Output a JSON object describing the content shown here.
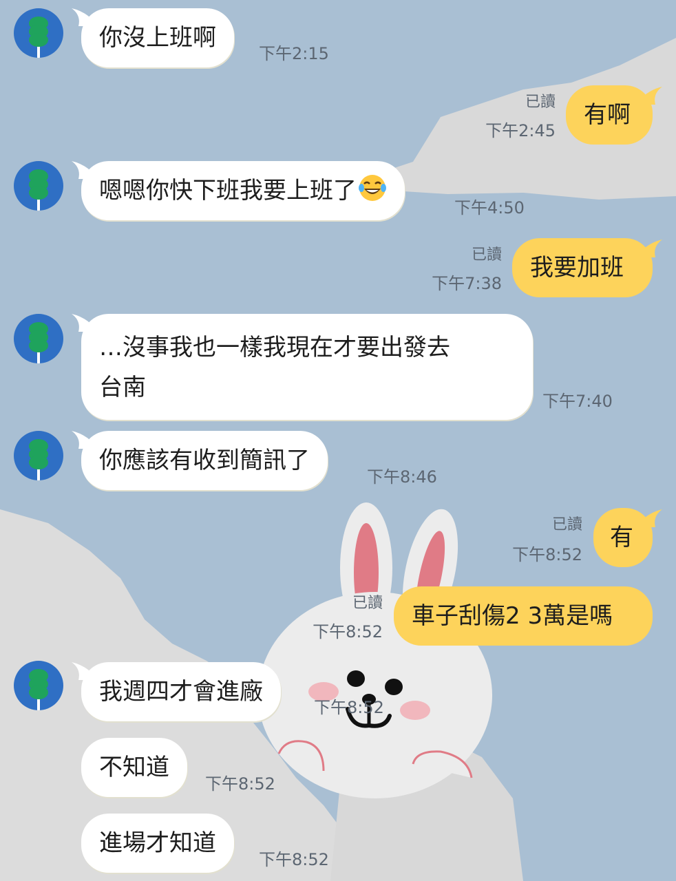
{
  "colors": {
    "background": "#a9bfd3",
    "incoming_bubble": "#ffffff",
    "outgoing_bubble": "#fdd35b",
    "avatar": "#2f6fc4",
    "avatar_icon": "#1fa35c"
  },
  "background_decor": "line-friends-cony-rabbit",
  "messages": [
    {
      "side": "in",
      "text": "你沒上班啊",
      "time": "下午2:15",
      "avatar_icon": "tree-icon"
    },
    {
      "side": "out",
      "text": "有啊",
      "read": "已讀",
      "time": "下午2:45"
    },
    {
      "side": "in",
      "text": "嗯嗯你快下班我要上班了",
      "emoji": "laughing-tears-emoji",
      "time": "下午4:50",
      "avatar_icon": "tree-icon"
    },
    {
      "side": "out",
      "text": "我要加班",
      "read": "已讀",
      "time": "下午7:38"
    },
    {
      "side": "in",
      "line1": "…沒事我也一樣我現在才要出發去",
      "line2": "台南",
      "time": "下午7:40",
      "avatar_icon": "tree-icon"
    },
    {
      "side": "in",
      "text": "你應該有收到簡訊了",
      "time": "下午8:46",
      "avatar_icon": "tree-icon"
    },
    {
      "side": "out",
      "text": "有",
      "read": "已讀",
      "time": "下午8:52"
    },
    {
      "side": "out",
      "text": "車子刮傷2 3萬是嗎",
      "read": "已讀",
      "time": "下午8:52"
    },
    {
      "side": "in",
      "text": "我週四才會進廠",
      "time": "下午8:52",
      "avatar_icon": "tree-icon"
    },
    {
      "side": "in",
      "text": "不知道",
      "time": "下午8:52"
    },
    {
      "side": "in",
      "text": "進場才知道",
      "time": "下午8:52"
    }
  ]
}
